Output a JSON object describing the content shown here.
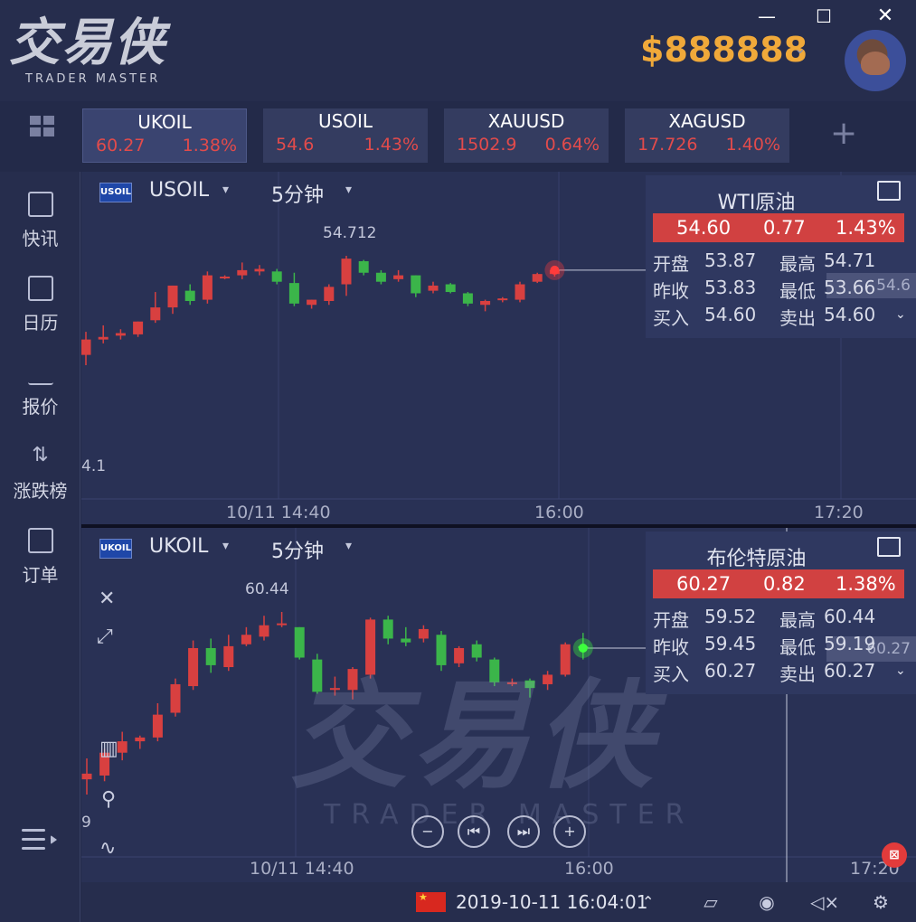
{
  "app": {
    "logo_zh": "交易侠",
    "logo_en": "TRADER MASTER",
    "balance": "$888888",
    "window": {
      "minimize": "—",
      "maximize": "☐",
      "close": "✕"
    }
  },
  "tickers": [
    {
      "symbol": "UKOIL",
      "price": "60.27",
      "change_pct": "1.38%"
    },
    {
      "symbol": "USOIL",
      "price": "54.6",
      "change_pct": "1.43%"
    },
    {
      "symbol": "XAUUSD",
      "price": "1502.9",
      "change_pct": "0.64%"
    },
    {
      "symbol": "XAGUSD",
      "price": "17.726",
      "change_pct": "1.40%"
    }
  ],
  "sidebar": {
    "items": [
      {
        "label": "快讯",
        "icon": "news-icon"
      },
      {
        "label": "日历",
        "icon": "calendar-icon"
      },
      {
        "label": "报价",
        "icon": "quote-trend-icon"
      },
      {
        "label": "涨跌榜",
        "icon": "rank-arrows-icon"
      },
      {
        "label": "订单",
        "icon": "order-icon"
      }
    ]
  },
  "panels": [
    {
      "badge": "USOIL",
      "symbol": "USOIL",
      "timeframe": "5分钟",
      "high_annotation": "54.712",
      "left_edge_label": "4.1",
      "x_labels": [
        "10/11 14:40",
        "16:00",
        "17:20"
      ],
      "quote": {
        "title": "WTI原油",
        "price": "54.60",
        "change": "0.77",
        "change_pct": "1.43%",
        "open_label": "开盘",
        "open": "53.87",
        "high_label": "最高",
        "high": "54.71",
        "prev_close_label": "昨收",
        "prev_close": "53.83",
        "low_label": "最低",
        "low": "53.66",
        "bid_label": "买入",
        "bid": "54.60",
        "ask_label": "卖出",
        "ask": "54.60",
        "price_tag": "54.6"
      }
    },
    {
      "badge": "UKOIL",
      "symbol": "UKOIL",
      "timeframe": "5分钟",
      "high_annotation": "60.44",
      "left_edge_label": "9",
      "x_labels": [
        "10/11 14:40",
        "16:00",
        "17:20"
      ],
      "quote": {
        "title": "布伦特原油",
        "price": "60.27",
        "change": "0.82",
        "change_pct": "1.38%",
        "open_label": "开盘",
        "open": "59.52",
        "high_label": "最高",
        "high": "60.44",
        "prev_close_label": "昨收",
        "prev_close": "59.45",
        "low_label": "最低",
        "low": "59.19",
        "bid_label": "买入",
        "bid": "60.27",
        "ask_label": "卖出",
        "ask": "60.27",
        "price_tag": "60.27"
      }
    }
  ],
  "watermark": {
    "zh": "交易侠",
    "en": "TRADER MASTER"
  },
  "statusbar": {
    "datetime": "2019-10-11 16:04:01"
  },
  "colors": {
    "up": "#d84040",
    "down": "#3bb54a",
    "accent": "#f0a93a",
    "panel": "#293155"
  },
  "chart_data": [
    {
      "type": "candlestick",
      "title": "USOIL",
      "timeframe": "5分钟",
      "x_tick_labels": [
        "10/11 14:40",
        "16:00",
        "17:20"
      ],
      "candles": [
        {
          "o": 53.94,
          "h": 54.12,
          "l": 53.86,
          "c": 54.06
        },
        {
          "o": 54.06,
          "h": 54.17,
          "l": 54.03,
          "c": 54.08
        },
        {
          "o": 54.09,
          "h": 54.14,
          "l": 54.06,
          "c": 54.11
        },
        {
          "o": 54.1,
          "h": 54.2,
          "l": 54.08,
          "c": 54.2
        },
        {
          "o": 54.21,
          "h": 54.43,
          "l": 54.19,
          "c": 54.31
        },
        {
          "o": 54.31,
          "h": 54.48,
          "l": 54.26,
          "c": 54.48
        },
        {
          "o": 54.44,
          "h": 54.49,
          "l": 54.33,
          "c": 54.36
        },
        {
          "o": 54.37,
          "h": 54.59,
          "l": 54.34,
          "c": 54.56
        },
        {
          "o": 54.55,
          "h": 54.56,
          "l": 54.53,
          "c": 54.55
        },
        {
          "o": 54.56,
          "h": 54.66,
          "l": 54.53,
          "c": 54.6
        },
        {
          "o": 54.59,
          "h": 54.64,
          "l": 54.56,
          "c": 54.61
        },
        {
          "o": 54.59,
          "h": 54.61,
          "l": 54.49,
          "c": 54.51
        },
        {
          "o": 54.5,
          "h": 54.58,
          "l": 54.32,
          "c": 54.34
        },
        {
          "o": 54.33,
          "h": 54.37,
          "l": 54.3,
          "c": 54.37
        },
        {
          "o": 54.36,
          "h": 54.49,
          "l": 54.33,
          "c": 54.47
        },
        {
          "o": 54.49,
          "h": 54.712,
          "l": 54.4,
          "c": 54.69
        },
        {
          "o": 54.67,
          "h": 54.68,
          "l": 54.56,
          "c": 54.58
        },
        {
          "o": 54.58,
          "h": 54.6,
          "l": 54.49,
          "c": 54.51
        },
        {
          "o": 54.53,
          "h": 54.6,
          "l": 54.51,
          "c": 54.56
        },
        {
          "o": 54.56,
          "h": 54.56,
          "l": 54.39,
          "c": 54.42
        },
        {
          "o": 54.44,
          "h": 54.51,
          "l": 54.42,
          "c": 54.48
        },
        {
          "o": 54.49,
          "h": 54.5,
          "l": 54.42,
          "c": 54.43
        },
        {
          "o": 54.42,
          "h": 54.43,
          "l": 54.32,
          "c": 54.34
        },
        {
          "o": 54.33,
          "h": 54.37,
          "l": 54.28,
          "c": 54.36
        },
        {
          "o": 54.38,
          "h": 54.39,
          "l": 54.35,
          "c": 54.38
        },
        {
          "o": 54.37,
          "h": 54.51,
          "l": 54.35,
          "c": 54.49
        },
        {
          "o": 54.51,
          "h": 54.58,
          "l": 54.5,
          "c": 54.57
        },
        {
          "o": 54.57,
          "h": 54.61,
          "l": 54.55,
          "c": 54.6
        }
      ]
    },
    {
      "type": "candlestick",
      "title": "UKOIL",
      "timeframe": "5分钟",
      "x_tick_labels": [
        "10/11 14:40",
        "16:00",
        "17:20"
      ],
      "candles": [
        {
          "o": 59.56,
          "h": 59.67,
          "l": 59.48,
          "c": 59.59
        },
        {
          "o": 59.58,
          "h": 59.72,
          "l": 59.55,
          "c": 59.7
        },
        {
          "o": 59.7,
          "h": 59.81,
          "l": 59.66,
          "c": 59.76
        },
        {
          "o": 59.76,
          "h": 59.79,
          "l": 59.72,
          "c": 59.78
        },
        {
          "o": 59.78,
          "h": 59.96,
          "l": 59.76,
          "c": 59.9
        },
        {
          "o": 59.91,
          "h": 60.09,
          "l": 59.89,
          "c": 60.06
        },
        {
          "o": 60.05,
          "h": 60.29,
          "l": 60.03,
          "c": 60.25
        },
        {
          "o": 60.25,
          "h": 60.3,
          "l": 60.12,
          "c": 60.16
        },
        {
          "o": 60.15,
          "h": 60.32,
          "l": 60.13,
          "c": 60.26
        },
        {
          "o": 60.27,
          "h": 60.36,
          "l": 60.26,
          "c": 60.32
        },
        {
          "o": 60.31,
          "h": 60.42,
          "l": 60.29,
          "c": 60.37
        },
        {
          "o": 60.38,
          "h": 60.44,
          "l": 60.36,
          "c": 60.38
        },
        {
          "o": 60.36,
          "h": 60.36,
          "l": 60.19,
          "c": 60.2
        },
        {
          "o": 60.19,
          "h": 60.22,
          "l": 60.01,
          "c": 60.02
        },
        {
          "o": 60.03,
          "h": 60.1,
          "l": 60.0,
          "c": 60.04
        },
        {
          "o": 60.03,
          "h": 60.15,
          "l": 59.98,
          "c": 60.14
        },
        {
          "o": 60.11,
          "h": 60.41,
          "l": 60.09,
          "c": 60.4
        },
        {
          "o": 60.4,
          "h": 60.42,
          "l": 60.27,
          "c": 60.3
        },
        {
          "o": 60.3,
          "h": 60.36,
          "l": 60.26,
          "c": 60.28
        },
        {
          "o": 60.3,
          "h": 60.37,
          "l": 60.28,
          "c": 60.35
        },
        {
          "o": 60.32,
          "h": 60.34,
          "l": 60.13,
          "c": 60.16
        },
        {
          "o": 60.17,
          "h": 60.26,
          "l": 60.15,
          "c": 60.25
        },
        {
          "o": 60.27,
          "h": 60.29,
          "l": 60.18,
          "c": 60.2
        },
        {
          "o": 60.19,
          "h": 60.2,
          "l": 60.05,
          "c": 60.07
        },
        {
          "o": 60.07,
          "h": 60.09,
          "l": 60.05,
          "c": 60.07
        },
        {
          "o": 60.08,
          "h": 60.09,
          "l": 59.99,
          "c": 60.04
        },
        {
          "o": 60.06,
          "h": 60.13,
          "l": 60.03,
          "c": 60.11
        },
        {
          "o": 60.11,
          "h": 60.28,
          "l": 60.1,
          "c": 60.27
        },
        {
          "o": 60.26,
          "h": 60.33,
          "l": 60.19,
          "c": 60.25
        }
      ]
    }
  ]
}
